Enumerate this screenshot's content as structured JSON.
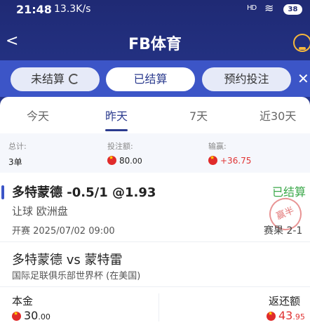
{
  "status_bar": {
    "time": "21:48",
    "speed": "13.3K/s",
    "signal": "HD",
    "battery": "38"
  },
  "header": {
    "title": "FB体育"
  },
  "status_tabs": [
    {
      "label": "未结算"
    },
    {
      "label": "已结算"
    },
    {
      "label": "预约投注"
    }
  ],
  "date_tabs": [
    "今天",
    "昨天",
    "7天",
    "近30天"
  ],
  "summary": {
    "total_label": "总计:",
    "total_value": "3单",
    "stake_label": "投注额:",
    "stake_value": "80",
    "stake_decimals": ".00",
    "pl_label": "输赢:",
    "pl_value": "+36.75"
  },
  "bet": {
    "pick": "多特蒙德 -0.5/1 @1.93",
    "status": "已结算",
    "type": "让球  欧洲盘",
    "kickoff": "开赛  2025/07/02 09:00",
    "stamp": "赢半",
    "result": "赛果  2-1",
    "match": "多特蒙德 vs 蒙特雷",
    "league": "国际足联俱乐部世界杯 (在美国)",
    "principal_label": "本金",
    "principal_value": "30",
    "principal_decimals": ".00",
    "return_label": "返还额",
    "return_value": "43",
    "return_decimals": ".95"
  },
  "colors": {
    "brand": "#243284",
    "accent": "#3c55c7",
    "win": "#3ba84a",
    "profit": "#e03434"
  }
}
